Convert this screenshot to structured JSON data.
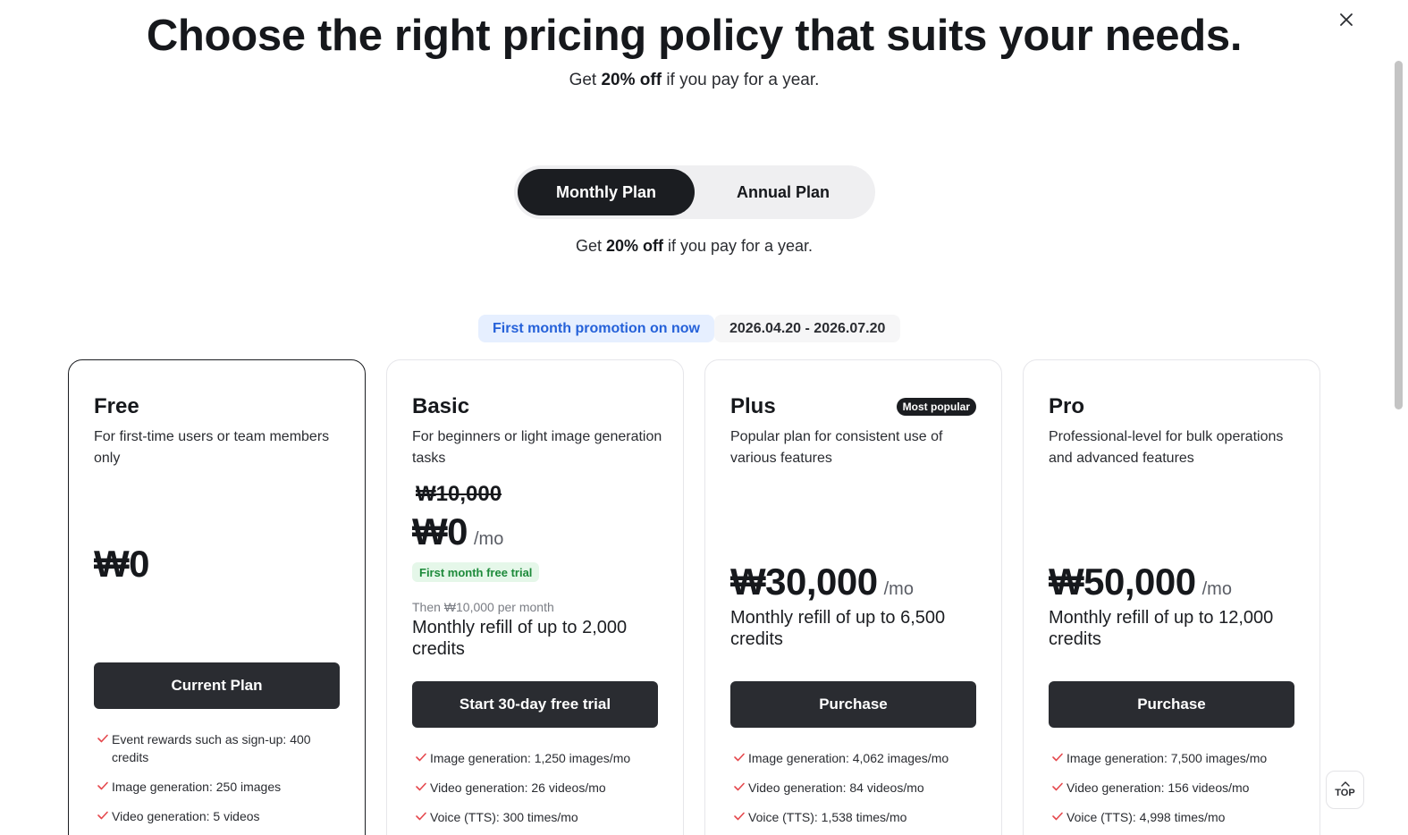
{
  "header": {
    "title": "Choose the right pricing policy that suits your needs.",
    "sub_pre": "Get ",
    "sub_bold": "20% off",
    "sub_post": " if you pay for a year."
  },
  "toggle": {
    "monthly_label": "Monthly Plan",
    "annual_label": "Annual Plan",
    "selected": "monthly"
  },
  "toggle_note": {
    "pre": "Get ",
    "bold": "20% off",
    "post": " if you pay for a year."
  },
  "promotion": {
    "badge": "First month promotion on now",
    "dates": "2026.04.20 - 2026.07.20"
  },
  "plans": [
    {
      "name": "Free",
      "description": "For first-time users or team members only",
      "price": "₩0",
      "cta": "Current Plan",
      "features": [
        "Event rewards such as sign-up: 400 credits",
        "Image generation: 250 images",
        "Video generation: 5 videos"
      ]
    },
    {
      "name": "Basic",
      "description": "For beginners or light image generation tasks",
      "original_price": "₩10,000",
      "price": "₩0",
      "per": "/mo",
      "trial_tag": "First month free trial",
      "then_text": "Then ₩10,000 per month",
      "credits": "Monthly refill of up to 2,000 credits",
      "cta": "Start 30-day free trial",
      "features": [
        "Image generation: 1,250 images/mo",
        "Video generation: 26 videos/mo",
        "Voice (TTS): 300 times/mo"
      ]
    },
    {
      "name": "Plus",
      "badge": "Most popular",
      "description": "Popular plan for consistent use of various features",
      "price": "₩30,000",
      "per": "/mo",
      "credits": "Monthly refill of up to 6,500 credits",
      "cta": "Purchase",
      "features": [
        "Image generation: 4,062 images/mo",
        "Video generation: 84 videos/mo",
        "Voice (TTS): 1,538 times/mo"
      ]
    },
    {
      "name": "Pro",
      "description": "Professional-level for bulk operations and advanced features",
      "price": "₩50,000",
      "per": "/mo",
      "credits": "Monthly refill of up to 12,000 credits",
      "cta": "Purchase",
      "features": [
        "Image generation: 7,500 images/mo",
        "Video generation: 156 videos/mo",
        "Voice (TTS): 4,998 times/mo"
      ]
    }
  ],
  "top_button": {
    "label": "TOP"
  },
  "icons": {
    "close": "close-icon",
    "check": "check-icon",
    "top": "arrow-up-icon"
  },
  "colors": {
    "accent_check": "#e5484d",
    "primary_dark": "#1b1d21",
    "promo_blue": "#2561d9",
    "trial_green": "#1d8a3a"
  }
}
